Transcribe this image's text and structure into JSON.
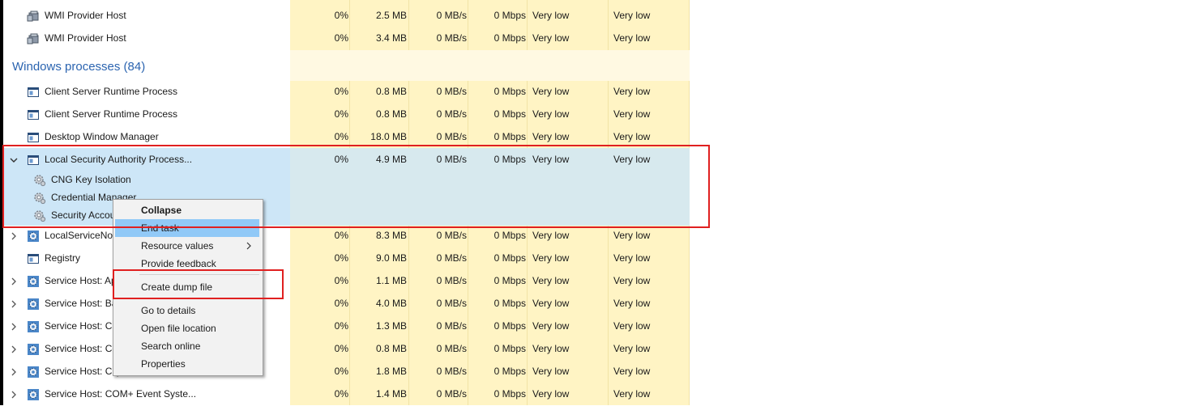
{
  "columns": {
    "cpu_bg": "#fff4c4",
    "accent": "#2b64b0",
    "highlight": "#e02020"
  },
  "rows_top": [
    {
      "name": "WMI Provider Host",
      "icon": "wmi-icon",
      "cpu": "0%",
      "mem": "2.5 MB",
      "disk": "0 MB/s",
      "net": "0 Mbps",
      "power": "Very low",
      "power_trend": "Very low"
    },
    {
      "name": "WMI Provider Host",
      "icon": "wmi-icon",
      "cpu": "0%",
      "mem": "3.4 MB",
      "disk": "0 MB/s",
      "net": "0 Mbps",
      "power": "Very low",
      "power_trend": "Very low"
    }
  ],
  "group": {
    "title": "Windows processes (84)"
  },
  "rows_win": [
    {
      "name": "Client Server Runtime Process",
      "icon": "window-icon",
      "cpu": "0%",
      "mem": "0.8 MB",
      "disk": "0 MB/s",
      "net": "0 Mbps",
      "power": "Very low",
      "power_trend": "Very low"
    },
    {
      "name": "Client Server Runtime Process",
      "icon": "window-icon",
      "cpu": "0%",
      "mem": "0.8 MB",
      "disk": "0 MB/s",
      "net": "0 Mbps",
      "power": "Very low",
      "power_trend": "Very low"
    },
    {
      "name": "Desktop Window Manager",
      "icon": "window-icon",
      "cpu": "0%",
      "mem": "18.0 MB",
      "disk": "0 MB/s",
      "net": "0 Mbps",
      "power": "Very low",
      "power_trend": "Very low"
    }
  ],
  "lsa": {
    "name": "Local Security Authority Process...",
    "cpu": "0%",
    "mem": "4.9 MB",
    "disk": "0 MB/s",
    "net": "0 Mbps",
    "power": "Very low",
    "power_trend": "Very low",
    "children": [
      "CNG Key Isolation",
      "Credential Manager",
      "Security Accou"
    ]
  },
  "rows_bottom": [
    {
      "name": "LocalServiceNoN",
      "icon": "gear-icon",
      "cpu": "0%",
      "mem": "8.3 MB",
      "disk": "0 MB/s",
      "net": "0 Mbps",
      "power": "Very low",
      "power_trend": "Very low"
    },
    {
      "name": "Registry",
      "icon": "window-icon",
      "cpu": "0%",
      "mem": "9.0 MB",
      "disk": "0 MB/s",
      "net": "0 Mbps",
      "power": "Very low",
      "power_trend": "Very low"
    },
    {
      "name": "Service Host: Ap",
      "icon": "gear-icon",
      "cpu": "0%",
      "mem": "1.1 MB",
      "disk": "0 MB/s",
      "net": "0 Mbps",
      "power": "Very low",
      "power_trend": "Very low"
    },
    {
      "name": "Service Host: Ba",
      "icon": "gear-icon",
      "cpu": "0%",
      "mem": "4.0 MB",
      "disk": "0 MB/s",
      "net": "0 Mbps",
      "power": "Very low",
      "power_trend": "Very low"
    },
    {
      "name": "Service Host: Ca",
      "icon": "gear-icon",
      "cpu": "0%",
      "mem": "1.3 MB",
      "disk": "0 MB/s",
      "net": "0 Mbps",
      "power": "Very low",
      "power_trend": "Very low"
    },
    {
      "name": "Service Host: Ce",
      "icon": "gear-icon",
      "cpu": "0%",
      "mem": "0.8 MB",
      "disk": "0 MB/s",
      "net": "0 Mbps",
      "power": "Very low",
      "power_trend": "Very low"
    },
    {
      "name": "Service Host: Clip",
      "icon": "gear-icon",
      "cpu": "0%",
      "mem": "1.8 MB",
      "disk": "0 MB/s",
      "net": "0 Mbps",
      "power": "Very low",
      "power_trend": "Very low"
    },
    {
      "name": "Service Host: COM+ Event Syste...",
      "icon": "gear-icon",
      "cpu": "0%",
      "mem": "1.4 MB",
      "disk": "0 MB/s",
      "net": "0 Mbps",
      "power": "Very low",
      "power_trend": "Very low"
    }
  ],
  "context_menu": {
    "collapse": "Collapse",
    "end_task": "End task",
    "resource_values": "Resource values",
    "provide_feedback": "Provide feedback",
    "create_dump": "Create dump file",
    "go_to_details": "Go to details",
    "open_file_location": "Open file location",
    "search_online": "Search online",
    "properties": "Properties"
  }
}
